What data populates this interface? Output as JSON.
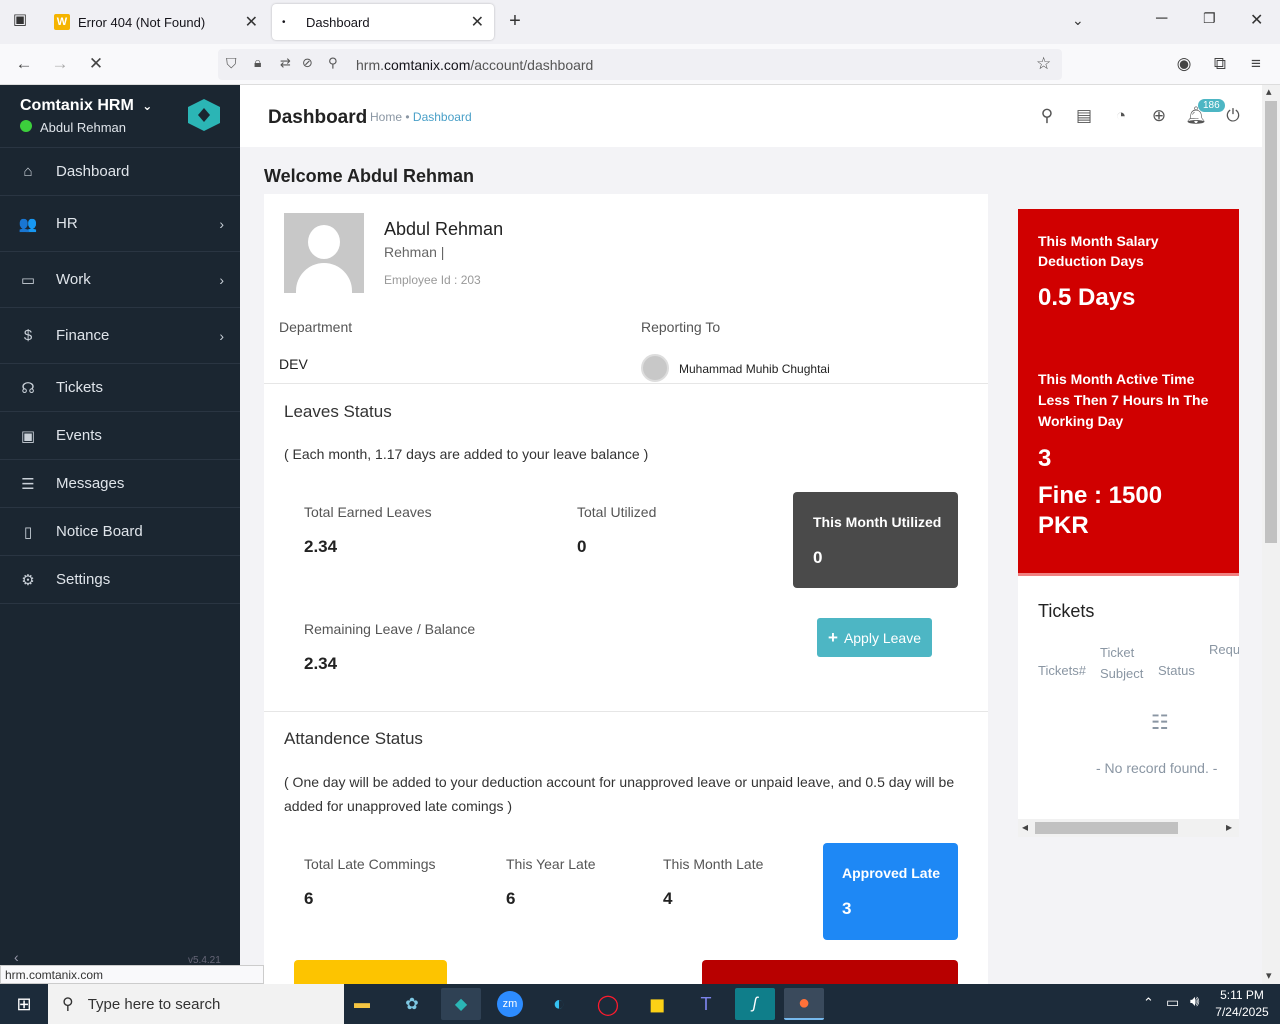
{
  "browser": {
    "tabs": [
      {
        "title": "Error 404 (Not Found)",
        "favicon": "W"
      },
      {
        "title": "Dashboard"
      }
    ],
    "url_prefix": "hrm.",
    "url_domain": "comtanix.com",
    "url_path": "/account/dashboard",
    "status_url": "hrm.comtanix.com"
  },
  "sidebar": {
    "app_name": "Comtanix HRM",
    "user_name": "Abdul Rehman",
    "items": [
      {
        "label": "Dashboard",
        "icon": "home-icon",
        "glyph": "⌂",
        "has_submenu": false
      },
      {
        "label": "HR",
        "icon": "users-icon",
        "glyph": "👥",
        "has_submenu": true
      },
      {
        "label": "Work",
        "icon": "briefcase-icon",
        "glyph": "▭",
        "has_submenu": true
      },
      {
        "label": "Finance",
        "icon": "dollar-icon",
        "glyph": "$",
        "has_submenu": true
      },
      {
        "label": "Tickets",
        "icon": "headset-icon",
        "glyph": "☊",
        "has_submenu": false
      },
      {
        "label": "Events",
        "icon": "calendar-icon",
        "glyph": "▣",
        "has_submenu": false
      },
      {
        "label": "Messages",
        "icon": "message-icon",
        "glyph": "☰",
        "has_submenu": false
      },
      {
        "label": "Notice Board",
        "icon": "clipboard-icon",
        "glyph": "▯",
        "has_submenu": false
      },
      {
        "label": "Settings",
        "icon": "gear-icon",
        "glyph": "⚙",
        "has_submenu": false
      }
    ],
    "version": "v5.4.21"
  },
  "header": {
    "title": "Dashboard",
    "breadcrumb_home": "Home",
    "breadcrumb_sep": "•",
    "breadcrumb_current": "Dashboard",
    "notification_count": "186"
  },
  "welcome": "Welcome Abdul Rehman",
  "profile": {
    "name": "Abdul Rehman",
    "subtitle": "Rehman |",
    "employee_id": "Employee Id : 203",
    "department_label": "Department",
    "department": "DEV",
    "reporting_label": "Reporting To",
    "reporting_to": "Muhammad Muhib Chughtai"
  },
  "leaves": {
    "title": "Leaves Status",
    "note": "( Each month, 1.17 days are added to your leave balance )",
    "earned_label": "Total Earned Leaves",
    "earned": "2.34",
    "utilized_label": "Total Utilized",
    "utilized": "0",
    "month_label": "This Month Utilized",
    "month": "0",
    "remaining_label": "Remaining Leave / Balance",
    "remaining": "2.34",
    "apply_label": "Apply Leave"
  },
  "attendance": {
    "title": "Attandence Status",
    "note": "( One day will be added to your deduction account for unapproved leave or unpaid leave, and 0.5 day will be added for unapproved late comings )",
    "late_label": "Total Late Commings",
    "late": "6",
    "year_label": "This Year Late",
    "year": "6",
    "month_label": "This Month Late",
    "month": "4",
    "approved_label": "Approved Late",
    "approved": "3"
  },
  "deduction": {
    "salary_label": "This Month Salary Deduction Days",
    "salary_value": "0.5 Days",
    "active_label": "This Month Active Time Less Then 7 Hours In The Working Day",
    "active_value": "3",
    "fine": "Fine : 1500 PKR"
  },
  "tickets": {
    "title": "Tickets",
    "col_id": "Tickets#",
    "col_subject_1": "Ticket",
    "col_subject_2": "Subject",
    "col_status": "Status",
    "col_req": "Requ",
    "empty": "- No record found. -"
  },
  "taskbar": {
    "search_placeholder": "Type here to search",
    "time": "5:11 PM",
    "date": "7/24/2025"
  },
  "colors": {
    "sidebar": "#1b2631",
    "accent_red": "#d00000",
    "accent_blue": "#1e88f5",
    "accent_teal": "#4db6c4",
    "dark_box": "#4a4a4a",
    "brand_teal": "#2bb5b5"
  }
}
